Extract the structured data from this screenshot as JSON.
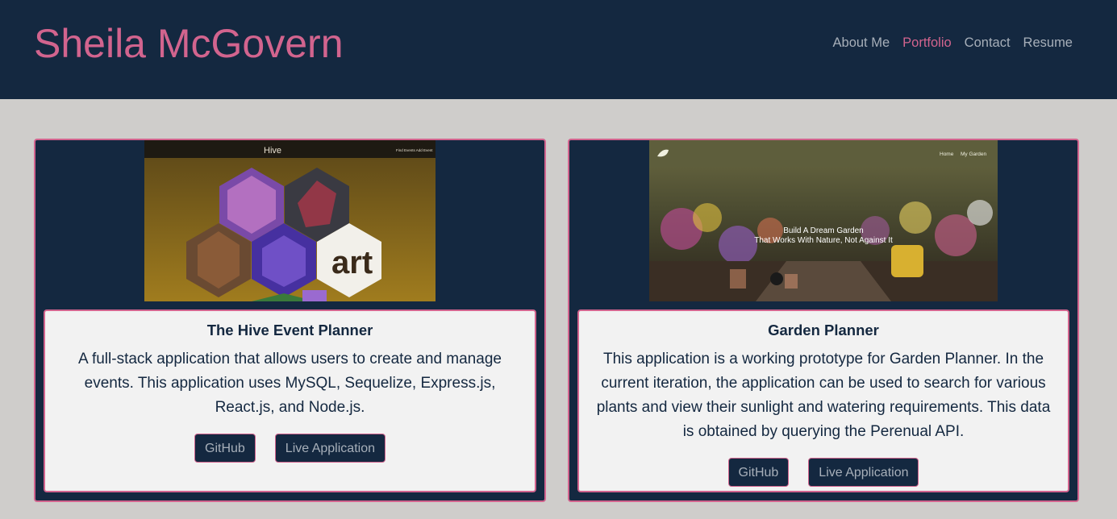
{
  "header": {
    "title": "Sheila McGovern",
    "nav": [
      {
        "label": "About Me",
        "active": false
      },
      {
        "label": "Portfolio",
        "active": true
      },
      {
        "label": "Contact",
        "active": false
      },
      {
        "label": "Resume",
        "active": false
      }
    ]
  },
  "projects": [
    {
      "title": "The Hive Event Planner",
      "description": "A full-stack application that allows users to create and manage events. This application uses MySQL, Sequelize, Express.js, React.js, and Node.js.",
      "github_label": "GitHub",
      "live_label": "Live Application",
      "screenshot": {
        "app_name": "Hive",
        "nav_text": "Find Events Add Event"
      }
    },
    {
      "title": "Garden Planner",
      "description": "This application is a working prototype for Garden Planner. In the current iteration, the application can be used to search for various plants and view their sunlight and watering requirements. This data is obtained by querying the Perenual API.",
      "github_label": "GitHub",
      "live_label": "Live Application",
      "screenshot": {
        "nav_home": "Home",
        "nav_garden": "My Garden",
        "hero_line1": "Build A Dream Garden",
        "hero_line2": "That Works With Nature, Not Against It"
      }
    }
  ],
  "colors": {
    "navy": "#142840",
    "pink": "#d2648e",
    "page_bg": "#cfcdcb",
    "nav_text": "#a7afb9"
  }
}
